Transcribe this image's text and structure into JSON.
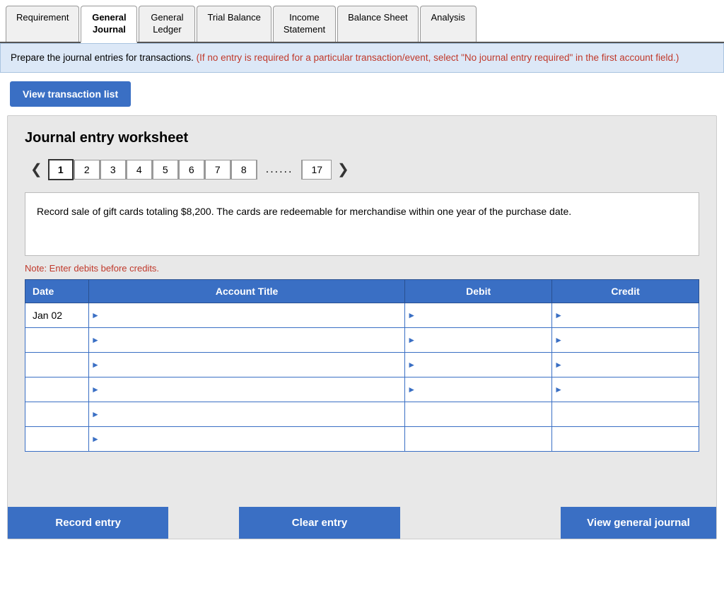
{
  "tabs": [
    {
      "id": "requirement",
      "label": "Requirement",
      "active": false
    },
    {
      "id": "general-journal",
      "label": "General\nJournal",
      "active": true
    },
    {
      "id": "general-ledger",
      "label": "General\nLedger",
      "active": false
    },
    {
      "id": "trial-balance",
      "label": "Trial Balance",
      "active": false
    },
    {
      "id": "income-statement",
      "label": "Income\nStatement",
      "active": false
    },
    {
      "id": "balance-sheet",
      "label": "Balance Sheet",
      "active": false
    },
    {
      "id": "analysis",
      "label": "Analysis",
      "active": false
    }
  ],
  "instruction": {
    "main": "Prepare the journal entries for transactions.",
    "red": "(If no entry is required for a particular transaction/event, select \"No journal entry required\" in the first account field.)"
  },
  "view_transaction_btn": "View transaction list",
  "worksheet": {
    "title": "Journal entry worksheet",
    "pages": [
      {
        "num": 1,
        "active": true
      },
      {
        "num": 2,
        "active": false
      },
      {
        "num": 3,
        "active": false
      },
      {
        "num": 4,
        "active": false
      },
      {
        "num": 5,
        "active": false
      },
      {
        "num": 6,
        "active": false
      },
      {
        "num": 7,
        "active": false
      },
      {
        "num": 8,
        "active": false
      },
      {
        "separator": "......"
      },
      {
        "num": 17,
        "active": false
      }
    ],
    "description": "Record sale of gift cards totaling $8,200. The cards are redeemable for merchandise within one year of the purchase date.",
    "note": "Note: Enter debits before credits.",
    "table": {
      "headers": [
        "Date",
        "Account Title",
        "Debit",
        "Credit"
      ],
      "rows": [
        {
          "date": "Jan 02",
          "account": "",
          "debit": "",
          "credit": ""
        },
        {
          "date": "",
          "account": "",
          "debit": "",
          "credit": ""
        },
        {
          "date": "",
          "account": "",
          "debit": "",
          "credit": ""
        },
        {
          "date": "",
          "account": "",
          "debit": "",
          "credit": ""
        },
        {
          "date": "",
          "account": "",
          "debit": "",
          "credit": ""
        },
        {
          "date": "",
          "account": "",
          "debit": "",
          "credit": ""
        }
      ]
    },
    "buttons": {
      "record": "Record entry",
      "clear": "Clear entry",
      "view_journal": "View general journal"
    }
  }
}
